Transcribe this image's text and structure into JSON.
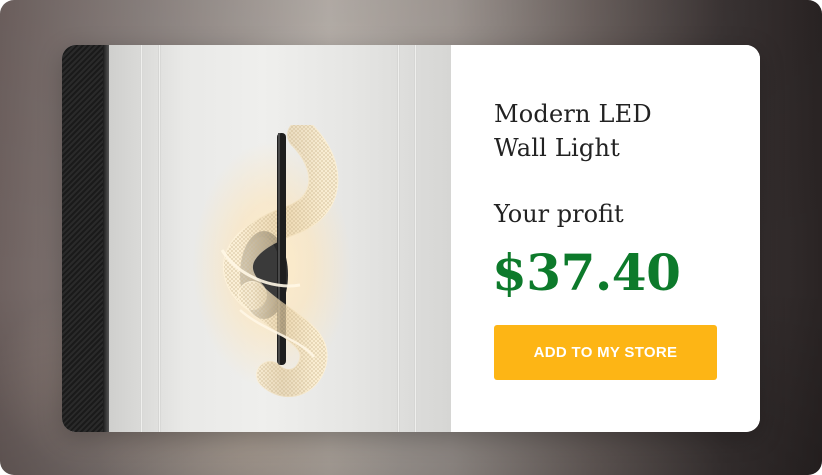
{
  "product": {
    "title_line1": "Modern LED",
    "title_line2": "Wall Light",
    "image_subject": "spiral LED wall sconce"
  },
  "profit": {
    "label": "Your profit",
    "amount": "$37.40"
  },
  "cta": {
    "label": "ADD TO MY STORE"
  },
  "colors": {
    "price_green": "#0d7a2b",
    "cta_yellow": "#fdb515",
    "card_bg": "#ffffff"
  }
}
